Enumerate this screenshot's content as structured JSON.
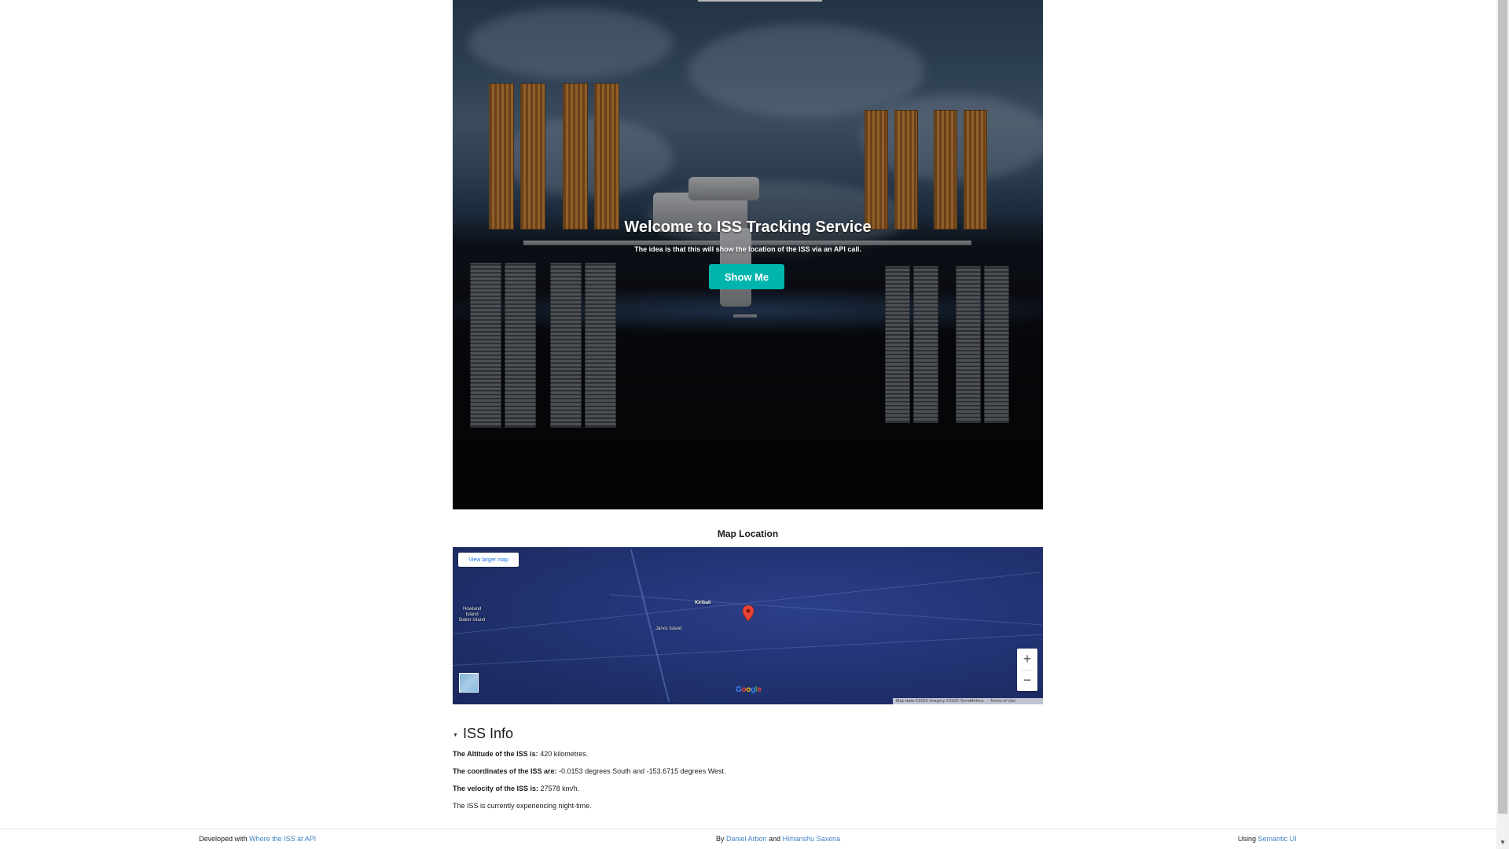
{
  "hero": {
    "title": "Welcome to ISS Tracking Service",
    "subtitle": "The idea is that this will show the location of the ISS via an API call.",
    "button_label": "Show Me",
    "button_color": "#00b5ad"
  },
  "map": {
    "heading": "Map Location",
    "larger_map_label": "View larger map",
    "labels": {
      "howland": "Howland\nIsland\nBaker Island",
      "kiribati": "Kiribati",
      "jarvis": "Jarvis Island"
    },
    "zoom_in": "+",
    "zoom_out": "−",
    "google_logo": "Google",
    "attribution": "Map data ©2020 Imagery ©2020 TerraMetrics",
    "terms": "Terms of Use",
    "pin_icon": "map-pin-icon"
  },
  "iss_info": {
    "heading": "ISS Info",
    "altitude_label": "The Altitude of the ISS is:",
    "altitude_value": "420 kilometres.",
    "coords_label": "The coordinates of the ISS are:",
    "coords_value": "-0.0153 degrees South and -153.6715 degrees West.",
    "velocity_label": "The velocity of the ISS is:",
    "velocity_value": "27578 km/h.",
    "visibility": "The ISS is currently experiencing night-time."
  },
  "footer": {
    "left_prefix": "Developed with",
    "left_link": "Where the ISS at API",
    "center_prefix": "By",
    "center_link1": "Daniel Arbon",
    "center_and": "and",
    "center_link2": "Himanshu Saxena",
    "right_prefix": "Using",
    "right_link": "Semantic UI",
    "link_color": "#4183c4"
  }
}
